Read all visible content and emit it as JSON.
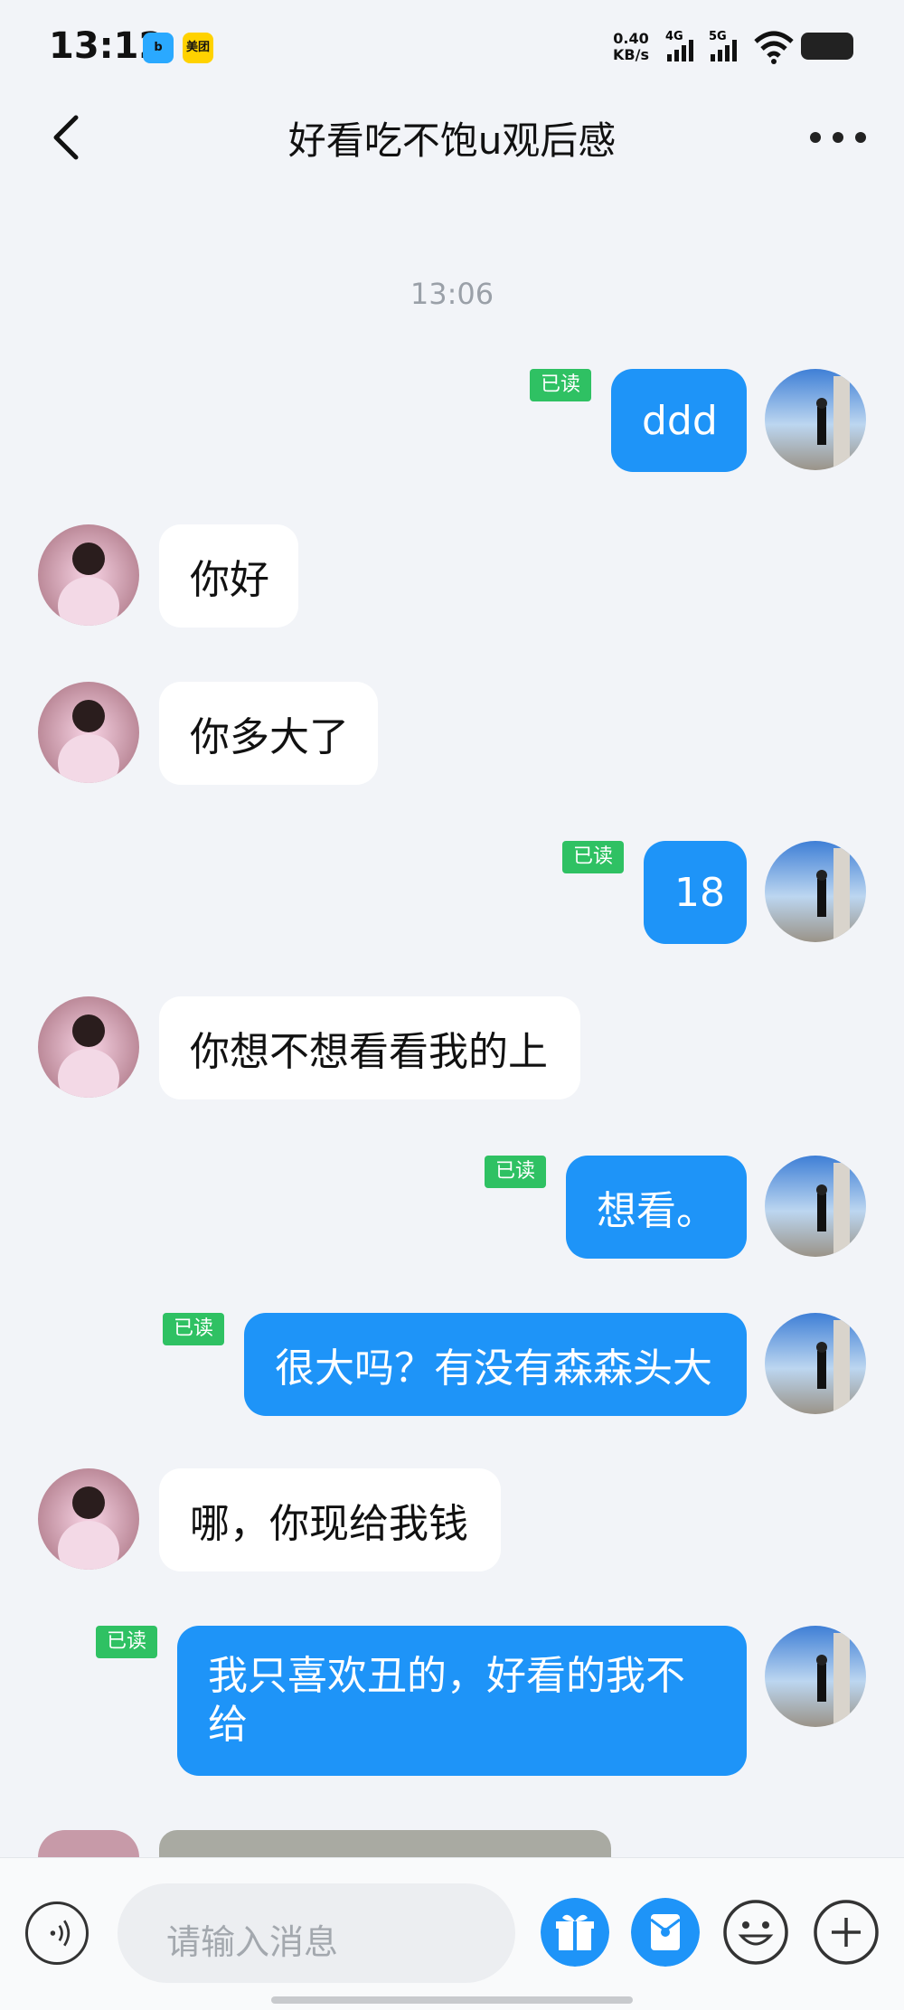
{
  "status_bar": {
    "time": "13:12",
    "badge1": "b",
    "badge2": "美团",
    "net_speed_1": "0.40",
    "net_speed_2": "KB/s",
    "sig1": "4G",
    "sig2": "5G"
  },
  "header": {
    "title": "好看吃不饱u观后感"
  },
  "conversation": {
    "timestamp": "13:06",
    "read_label": "已读",
    "messages": [
      {
        "from": "me",
        "text": "ddd"
      },
      {
        "from": "peer",
        "text": "你好"
      },
      {
        "from": "peer",
        "text": "你多大了"
      },
      {
        "from": "me",
        "text": "18"
      },
      {
        "from": "peer",
        "text": "你想不想看看我的上"
      },
      {
        "from": "me",
        "text": "想看。"
      },
      {
        "from": "me",
        "text": "很大吗？有没有森森头大"
      },
      {
        "from": "peer",
        "text": "哪，你现给我钱"
      },
      {
        "from": "me",
        "text_line1": "我只喜欢丑的，好看的我不",
        "text_line2": "给"
      }
    ]
  },
  "input_bar": {
    "placeholder": "请输入消息"
  },
  "colors": {
    "my_bubble": "#1e94f8",
    "peer_bubble": "#ffffff",
    "read_badge": "#2fc163",
    "background": "#f2f4f8"
  },
  "icons": [
    "back-arrow-icon",
    "more-icon",
    "voice-icon",
    "gift-icon",
    "red-packet-icon",
    "emoji-icon",
    "plus-icon"
  ]
}
